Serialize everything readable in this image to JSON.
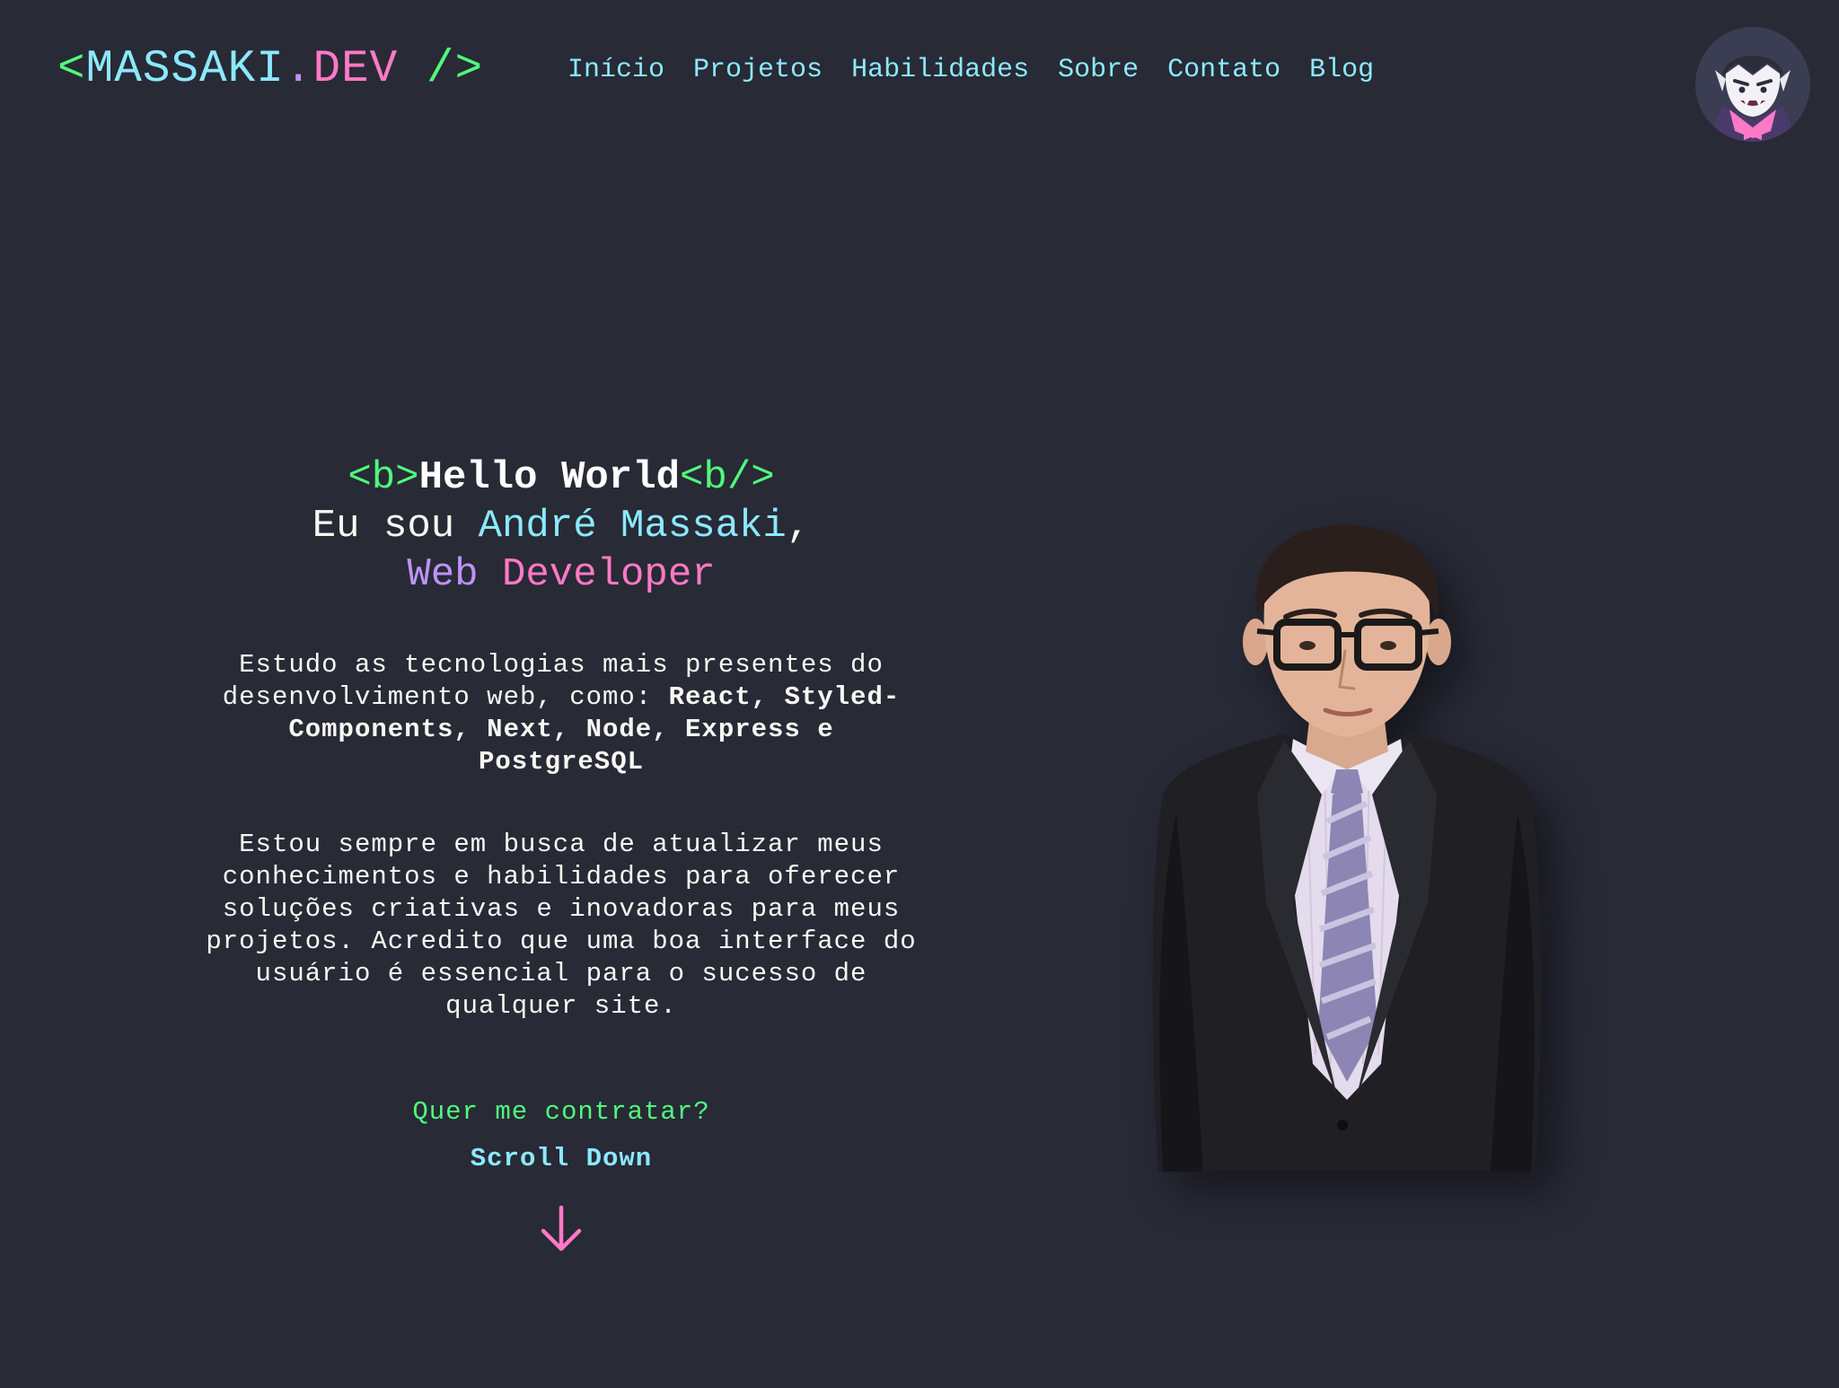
{
  "header": {
    "logo": {
      "open": "<",
      "brand": "MASSAKI",
      "dot": ".",
      "tld": "DEV",
      "close": " />"
    },
    "nav": [
      {
        "label": "Início"
      },
      {
        "label": "Projetos"
      },
      {
        "label": "Habilidades"
      },
      {
        "label": "Sobre"
      },
      {
        "label": "Contato"
      },
      {
        "label": "Blog"
      }
    ],
    "avatar_icon": "vampire-avatar-icon"
  },
  "hero": {
    "greeting_open_tag": "<b>",
    "greeting": "Hello World",
    "greeting_close_tag": "<b/>",
    "intro_prefix": "Eu sou ",
    "name": "André Massaki",
    "intro_suffix": ",",
    "role_first": "Web",
    "role_second": "Developer",
    "para1_text": "Estudo as tecnologias mais presentes do desenvolvimento web, como: ",
    "para1_tech": "React, Styled-Components, Next, Node, Express e PostgreSQL",
    "para2": "Estou sempre em busca de atualizar meus conhecimentos e habilidades para oferecer soluções criativas e inovadoras para meus projetos. Acredito que uma boa interface do usuário é essencial para o sucesso de qualquer site.",
    "hire_question": "Quer me contratar?",
    "scroll_label": "Scroll Down",
    "scroll_icon": "arrow-down-icon"
  },
  "colors": {
    "background": "#282a36",
    "green": "#50fa7b",
    "cyan": "#8be9fd",
    "pink": "#ff79c6",
    "purple": "#bd93f9",
    "text": "#f8f8f2"
  }
}
